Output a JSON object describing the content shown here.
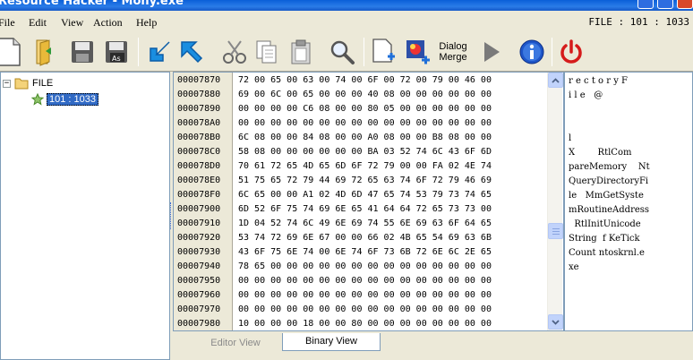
{
  "window": {
    "title": "Resource Hacker - Mony.exe"
  },
  "menu": {
    "items": [
      {
        "label": "File",
        "accel": "F"
      },
      {
        "label": "Edit",
        "accel": "E"
      },
      {
        "label": "View",
        "accel": "V"
      },
      {
        "label": "Action",
        "accel": "A"
      },
      {
        "label": "Help",
        "accel": "H"
      }
    ],
    "info": "FILE : 101 : 1033"
  },
  "toolbar": {
    "dialog_merge_label_1": "Dialog",
    "dialog_merge_label_2": "Merge",
    "icons": [
      "new-file-icon",
      "open-folder-icon",
      "save-icon",
      "save-as-icon",
      "import-arrow-icon",
      "export-arrow-icon",
      "cut-icon",
      "copy-icon",
      "paste-icon",
      "search-icon",
      "add-resource-icon",
      "add-image-icon",
      "dialog-merger-icon",
      "run-icon",
      "about-icon",
      "exit-icon"
    ],
    "colors": {
      "arrow": "#1a8ee0",
      "play": "#7a7a7a",
      "info": "#1e55c8",
      "power": "#d51b1b"
    }
  },
  "tree": {
    "root": {
      "expander": "−",
      "label": "FILE"
    },
    "child": {
      "label": "101 : 1033"
    }
  },
  "hex": {
    "rows": [
      {
        "addr": "00007870",
        "bytes": "72 00 65 00 63 00 74 00 6F 00 72 00 79 00 46 00"
      },
      {
        "addr": "00007880",
        "bytes": "69 00 6C 00 65 00 00 00 40 08 00 00 00 00 00 00"
      },
      {
        "addr": "00007890",
        "bytes": "00 00 00 00 C6 08 00 00 80 05 00 00 00 00 00 00"
      },
      {
        "addr": "000078A0",
        "bytes": "00 00 00 00 00 00 00 00 00 00 00 00 00 00 00 00"
      },
      {
        "addr": "000078B0",
        "bytes": "6C 08 00 00 84 08 00 00 A0 08 00 00 B8 08 00 00"
      },
      {
        "addr": "000078C0",
        "bytes": "58 08 00 00 00 00 00 00 BA 03 52 74 6C 43 6F 6D"
      },
      {
        "addr": "000078D0",
        "bytes": "70 61 72 65 4D 65 6D 6F 72 79 00 00 FA 02 4E 74"
      },
      {
        "addr": "000078E0",
        "bytes": "51 75 65 72 79 44 69 72 65 63 74 6F 72 79 46 69"
      },
      {
        "addr": "000078F0",
        "bytes": "6C 65 00 00 A1 02 4D 6D 47 65 74 53 79 73 74 65"
      },
      {
        "addr": "00007900",
        "bytes": "6D 52 6F 75 74 69 6E 65 41 64 64 72 65 73 73 00"
      },
      {
        "addr": "00007910",
        "bytes": "1D 04 52 74 6C 49 6E 69 74 55 6E 69 63 6F 64 65"
      },
      {
        "addr": "00007920",
        "bytes": "53 74 72 69 6E 67 00 00 66 02 4B 65 54 69 63 6B"
      },
      {
        "addr": "00007930",
        "bytes": "43 6F 75 6E 74 00 6E 74 6F 73 6B 72 6E 6C 2E 65"
      },
      {
        "addr": "00007940",
        "bytes": "78 65 00 00 00 00 00 00 00 00 00 00 00 00 00 00"
      },
      {
        "addr": "00007950",
        "bytes": "00 00 00 00 00 00 00 00 00 00 00 00 00 00 00 00"
      },
      {
        "addr": "00007960",
        "bytes": "00 00 00 00 00 00 00 00 00 00 00 00 00 00 00 00"
      },
      {
        "addr": "00007970",
        "bytes": "00 00 00 00 00 00 00 00 00 00 00 00 00 00 00 00"
      },
      {
        "addr": "00007980",
        "bytes": "10 00 00 00 18 00 00 80 00 00 00 00 00 00 00 00"
      }
    ]
  },
  "text": {
    "lines": [
      "r e c t o r y F",
      "i l e   @",
      "",
      "",
      "l",
      "X        RtlCom",
      "pareMemory    Nt",
      "QueryDirectoryFi",
      "le   MmGetSyste",
      "mRoutineAddress",
      "  RtlInitUnicode",
      "String  f KeTick",
      "Count ntoskrnl.e",
      "xe"
    ]
  },
  "tabs": {
    "editor_view": "Editor View",
    "binary_view": "Binary View"
  }
}
